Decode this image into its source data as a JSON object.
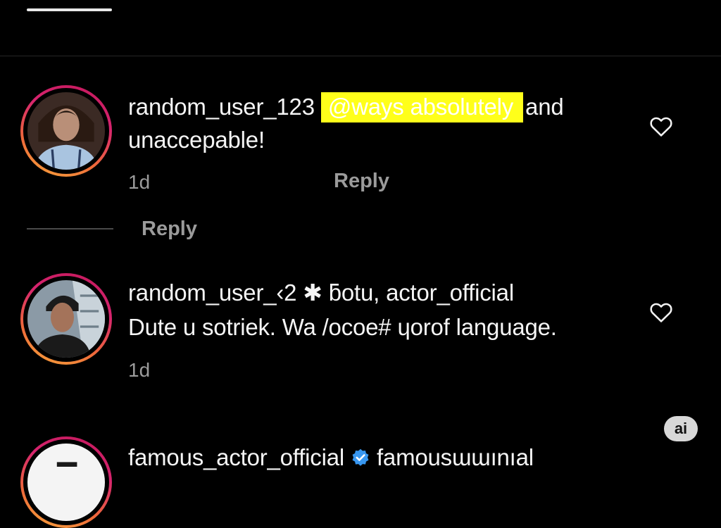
{
  "comments": [
    {
      "username": "random_user_123",
      "mention": "@ways absolutely",
      "text_after_mention": "and",
      "text_line2": "unaccepable!",
      "time": "1d",
      "reply_label": "Reply"
    },
    {
      "line1": "random_user_‹2 ✱ ƃotu, actor_official",
      "line2": "Dute u sotriek. Wa /ocoe# ɥorof language.",
      "time": "1d"
    },
    {
      "username": "famous_actor_official",
      "text_after_badge": "famousɯɯınıal"
    }
  ],
  "view_replies_label": "Reply",
  "ai_badge": "ai",
  "colors": {
    "background": "#000000",
    "highlight": "#ffff1a",
    "verified": "#3897f0",
    "muted_text": "#9b9b9b"
  },
  "icons": {
    "like": "heart-icon",
    "verified": "verified-badge-icon"
  }
}
